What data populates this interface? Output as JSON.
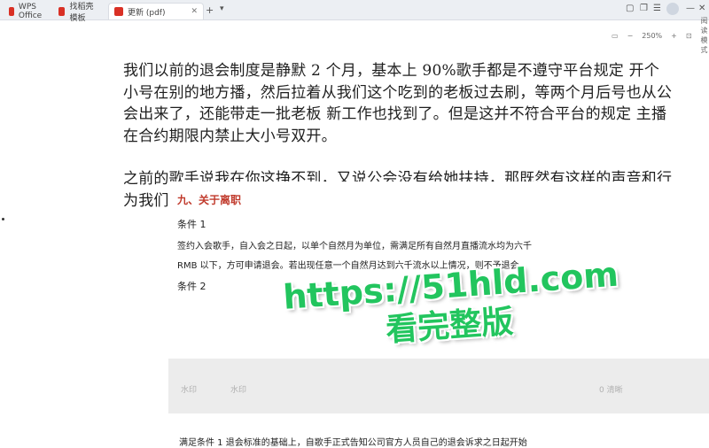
{
  "tabs": [
    {
      "label": "WPS Office"
    },
    {
      "label": "找稻壳模板"
    },
    {
      "label": "更新 (pdf)"
    }
  ],
  "toolbar": {
    "zoom": "250%",
    "read_label": "阅读模式"
  },
  "document": {
    "paragraph1": "我们以前的退会制度是静默 2 个月，基本上 90%歌手都是不遵守平台规定 开个小号在别的地方播，然后拉着从我们这个吃到的老板过去刷，等两个月后号也从公会出来了，还能带走一批老板 新工作也找到了。但是这并不符合平台的规定 主播在合约期限内禁止大小号双开。",
    "paragraph2": "之前的歌手说我在你这挣不到，又说公会没有给她扶持，那既然有这样的声音和行为我们的退会制度只能有所变更"
  },
  "embedded": {
    "heading": "九、关于离职",
    "cond1": "条件 1",
    "cond1_text1": "签约入会歌手，自入会之日起，以单个自然月为单位，需满足所有自然月直播流水均为六千",
    "cond1_text2": "RMB 以下，方可申请退会。若出现任意一个自然月达到六千流水以上情况，则不予退会。",
    "cond2": "条件 2",
    "wm_a": "水印",
    "wm_b": "水印",
    "wm_c": "0 清晰",
    "bottom_text": "满足条件 1 退会标准的基础上，自歌手正式告知公司官方人员自己的退会诉求之日起开始"
  },
  "overlay": {
    "line1": "https://51hld.com",
    "line2": "看完整版"
  }
}
